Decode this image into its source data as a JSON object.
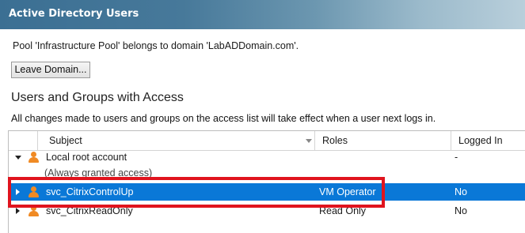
{
  "window": {
    "title": "Active Directory Users"
  },
  "pool_info": "Pool 'Infrastructure Pool' belongs to domain 'LabADDomain.com'.",
  "leave_domain_button": "Leave Domain...",
  "section_title": "Users and Groups with Access",
  "note": "All changes made to users and groups on the access list will take effect when a user next logs in.",
  "table": {
    "columns": [
      "Subject",
      "Roles",
      "Logged In"
    ],
    "rows": [
      {
        "subject": "Local root account",
        "role": "",
        "logged_in": "-",
        "expanded": true
      },
      {
        "subject": "(Always granted access)",
        "role": "",
        "logged_in": ""
      },
      {
        "subject": "svc_CitrixControlUp",
        "role": "VM Operator",
        "logged_in": "No",
        "selected": true
      },
      {
        "subject": "svc_CitrixReadOnly",
        "role": "Read Only",
        "logged_in": "No"
      }
    ]
  },
  "colors": {
    "title_bar": "#3b6f93",
    "selection": "#0a78d7",
    "highlight_box": "#e0141e",
    "user_icon": "#f08a24"
  },
  "icons": [
    "user-icon",
    "expand-arrow-icon",
    "collapse-arrow-icon",
    "sort-arrow-icon"
  ]
}
